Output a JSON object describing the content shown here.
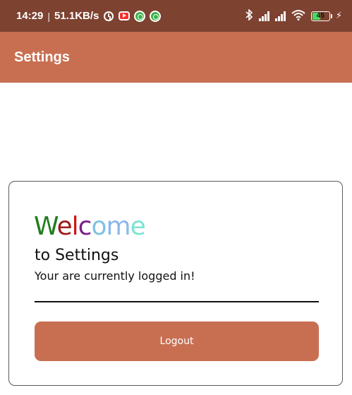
{
  "status_bar": {
    "time": "14:29",
    "separator": "|",
    "network_speed": "51.1KB/s",
    "battery_level": "45",
    "battery_fraction": 0.45,
    "icons": [
      "alarm-icon",
      "youtube-icon",
      "app-icon",
      "app-icon",
      "bluetooth-icon",
      "signal-icon",
      "signal-icon",
      "wifi-icon",
      "battery-icon",
      "charging-icon"
    ]
  },
  "app_bar": {
    "title": "Settings"
  },
  "card": {
    "welcome_letters": [
      "W",
      "e",
      "l",
      "c",
      "o",
      "m",
      "e"
    ],
    "subtitle": "to Settings",
    "status_text": "Your are currently logged in!",
    "logout_label": "Logout"
  },
  "colors": {
    "status_bar": "#7d4230",
    "accent": "#c86f52",
    "welcome": [
      "#1f7d1f",
      "#a01919",
      "#d11515",
      "#7a1f8a",
      "#7ec3e0",
      "#8ab8ea",
      "#7ee3d2"
    ]
  }
}
